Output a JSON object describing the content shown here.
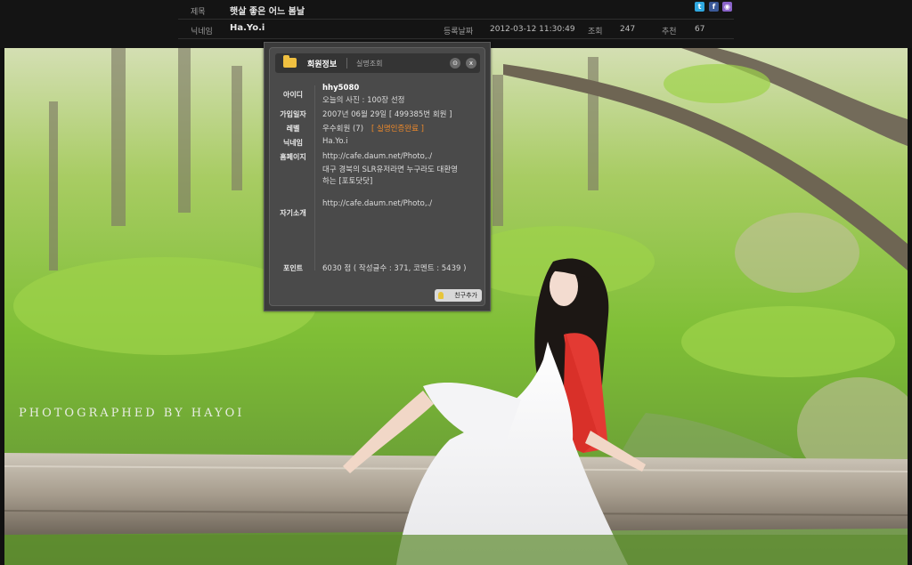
{
  "header": {
    "title_label": "제목",
    "title_value": "햇살 좋은 어느 봄날",
    "nick_label": "닉네임",
    "nick_value": "Ha.Yo.i",
    "date_label": "등록날짜",
    "date_value": "2012-03-12 11:30:49",
    "views_label": "조회",
    "views_value": "247",
    "recommend_label": "추천",
    "recommend_value": "67",
    "share_icons": [
      {
        "name": "twitter-icon",
        "glyph": "t",
        "color": "#2fa8e0"
      },
      {
        "name": "facebook-icon",
        "glyph": "f",
        "color": "#3b5998"
      },
      {
        "name": "me2day-icon",
        "glyph": "◉",
        "color": "#8a63c9"
      }
    ]
  },
  "photo": {
    "watermark": "PHOTOGRAPHED BY HAYOI"
  },
  "popup": {
    "tab_active": "회원정보",
    "tab_inactive": "실명조회",
    "labels": {
      "id": "아이디",
      "join_date": "가입일자",
      "level": "레벨",
      "nickname": "닉네임",
      "homepage": "홈페이지",
      "intro": "자기소개",
      "points": "포인트"
    },
    "values": {
      "id": "hhy5080",
      "highlight": "오늘의 사진 : 100장 선정",
      "join_date": "2007년 06월 29일 [ 499385번 회원 ]",
      "level": "우수회원 (7)",
      "level_badge": "[ 실명인증완료 ]",
      "nickname": "Ha.Yo.i",
      "homepage_url": "http://cafe.daum.net/Photo,./",
      "homepage_desc_1": "대구 경북의 SLR유저라면 누구라도 대환영",
      "homepage_desc_2": "하는 [포토닷닷]",
      "intro_url": "http://cafe.daum.net/Photo,./",
      "points": "6030 점 ( 작성글수 : 371, 코멘트 : 5439 )"
    },
    "settings_glyph": "⊙",
    "close_glyph": "x",
    "add_friend": "친구추가"
  }
}
